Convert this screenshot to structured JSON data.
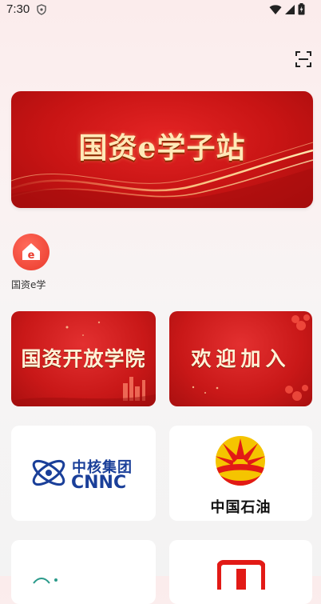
{
  "status_bar": {
    "time": "7:30"
  },
  "banner": {
    "title": "国资e学子站"
  },
  "app": {
    "label": "国资e学"
  },
  "cards": {
    "academy": {
      "title": "国资开放学院"
    },
    "welcome": {
      "title": "欢迎加入"
    },
    "cnnc": {
      "name_cn": "中核集团",
      "name_en": "CNNC"
    },
    "petrochina": {
      "name_cn": "中国石油"
    }
  },
  "colors": {
    "brand_red": "#c91818",
    "gold": "#ffe9b8",
    "cnnc_blue": "#1a3f99",
    "petro_yellow": "#f5c400"
  }
}
